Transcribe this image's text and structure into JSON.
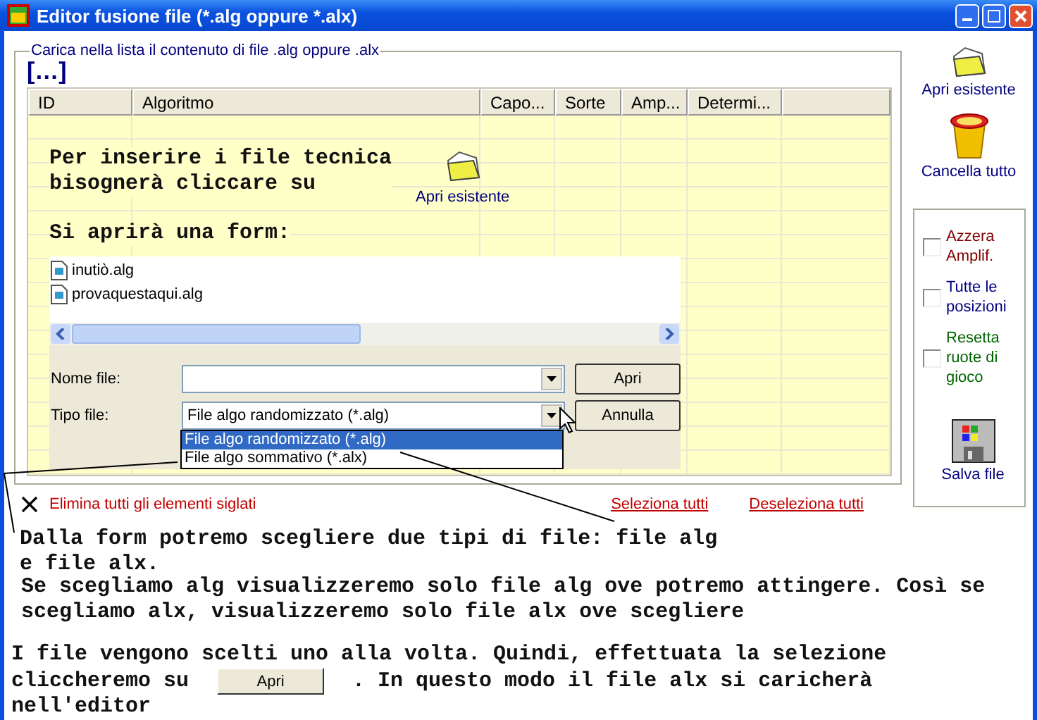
{
  "window": {
    "title": "Editor fusione file (*.alg oppure *.alx)"
  },
  "group_box": {
    "legend": "Carica nella lista il contenuto di file .alg oppure .alx",
    "indicator": "[…]"
  },
  "table": {
    "columns": [
      "ID",
      "Algoritmo",
      "Capo...",
      "Sorte",
      "Amp...",
      "Determi..."
    ]
  },
  "footer": {
    "delete_label": "Elimina tutti gli elementi siglati",
    "select_all": "Seleziona tutti",
    "deselect_all": "Deseleziona tutti"
  },
  "sidebar": {
    "open_label": "Apri esistente",
    "clear_label": "Cancella tutto",
    "save_label": "Salva file",
    "options": [
      {
        "label": "Azzera Amplif.",
        "checked": false,
        "color": "#800000"
      },
      {
        "label": "Tutte le posizioni",
        "checked": false,
        "color": "#000080"
      },
      {
        "label": "Resetta ruote di gioco",
        "checked": false,
        "color": "#006400"
      }
    ]
  },
  "tutorial": {
    "intro_lines": [
      "Per inserire i file tecnica",
      "bisognerà cliccare su"
    ],
    "intro_icon_label": "Apri esistente",
    "form_line": "Si aprirà una form:",
    "paragraph_1": [
      "Dalla form potremo scegliere due tipi di file: file alg",
      "e file alx."
    ],
    "paragraph_2": [
      "Se scegliamo alg visualizzeremo solo file alg ove potremo attingere. Così se",
      "scegliamo alx, visualizzeremo solo file alx ove scegliere"
    ],
    "paragraph_3": {
      "line_1": "I file vengono scelti uno alla volta. Quindi, effettuata la selezione",
      "before_button": "cliccheremo su",
      "button": "Apri",
      "after_button": ". In questo modo il file alx si caricherà",
      "line_3": "nell'editor"
    }
  },
  "dialog": {
    "files": [
      "inutiò.alg",
      "provaquestaqui.alg"
    ],
    "name_label": "Nome file:",
    "type_label": "Tipo file:",
    "type_value": "File algo randomizzato (*.alg)",
    "open_button": "Apri",
    "cancel_button": "Annulla",
    "type_options": [
      {
        "label": "File algo randomizzato (*.alg)",
        "selected": true
      },
      {
        "label": "File algo sommativo (*.alx)",
        "selected": false
      }
    ]
  }
}
